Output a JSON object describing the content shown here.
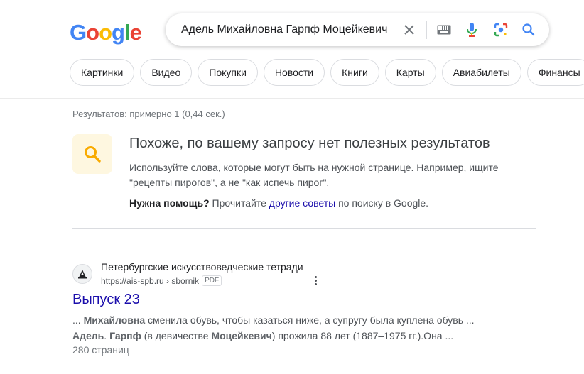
{
  "logo": {
    "letters": [
      "G",
      "o",
      "o",
      "g",
      "l",
      "e"
    ],
    "colors": [
      "#4285f4",
      "#ea4335",
      "#fbbc05",
      "#4285f4",
      "#34a853",
      "#ea4335"
    ]
  },
  "search": {
    "query": "Адель Михайловна Гарпф Моцейкевич",
    "icons": [
      "close-icon",
      "keyboard-icon",
      "mic-icon",
      "lens-icon",
      "search-icon"
    ]
  },
  "chips": [
    "Картинки",
    "Видео",
    "Покупки",
    "Новости",
    "Книги",
    "Карты",
    "Авиабилеты",
    "Финансы"
  ],
  "stats": "Результатов: примерно 1 (0,44 сек.)",
  "no_results": {
    "title": "Похоже, по вашему запросу нет полезных результатов",
    "line1": "Используйте слова, которые могут быть на нужной странице. Например, ищите",
    "line2": "\"рецепты пирогов\", а не \"как испечь пирог\".",
    "help_bold": "Нужна помощь?",
    "help_pre": " Прочитайте ",
    "help_link": "другие советы",
    "help_post": " по поиску в Google."
  },
  "result": {
    "site": "Петербургские искусствоведческие тетради",
    "url": "https://ais-spb.ru › sbornik",
    "badge": "PDF",
    "title": "Выпуск 23",
    "snip1_a": "... ",
    "snip1_b": "Михайловна",
    "snip1_c": " сменила обувь, чтобы казаться ниже, а супругу была куплена обувь ...",
    "snip2_a": "Адель",
    "snip2_b": ". ",
    "snip2_c": "Гарпф",
    "snip2_d": " (в девичестве ",
    "snip2_e": "Моцейкевич",
    "snip2_f": ") прожила 88 лет (1887–1975 гг.).Она ...",
    "pages": "280 страниц"
  }
}
